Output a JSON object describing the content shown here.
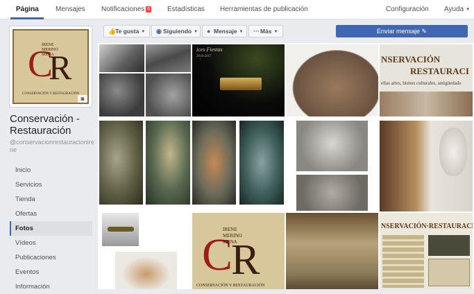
{
  "topnav": {
    "items": [
      "Página",
      "Mensajes",
      "Notificaciones",
      "Estadísticas",
      "Herramientas de publicación"
    ],
    "notifications_badge": "6",
    "settings": "Configuración",
    "help": "Ayuda"
  },
  "page": {
    "name": "Conservación - Restauración",
    "handle": "@conservacionrestauracionirene"
  },
  "logo": {
    "lines": [
      "IRENE",
      "MERINO",
      "MENA"
    ],
    "monogram": "CR",
    "caption": "CONSERVACIÓN Y RESTAURACIÓN"
  },
  "sidenav": {
    "items": [
      "Inicio",
      "Servicios",
      "Tienda",
      "Ofertas",
      "Fotos",
      "Vídeos",
      "Publicaciones",
      "Eventos",
      "Información"
    ],
    "active": "Fotos"
  },
  "actions": {
    "like": "Te gusta",
    "follow": "Siguiendo",
    "message": "Mensaje",
    "more": "Más",
    "send_message": "Enviar mensaje"
  },
  "photo_text": {
    "fiestas_title": "ices Fiestas",
    "fiestas_year": "2016-2017",
    "banner1_title": "NSERVACIÓN",
    "banner1_sub": "RESTAURACI",
    "banner1_line": "ellas artes, bienes culturales, antigüedade",
    "banner2_title": "NSERVACIÓN·RESTAURACI",
    "logo2_lines": [
      "IRENE",
      "MERINO",
      "MENA"
    ],
    "logo2_caption": "CONSERVACIÓN Y RESTAURACIÓN"
  },
  "colors": {
    "accent": "#4267b2",
    "badge": "#fa3e3e",
    "logo_bg": "#d8c79a",
    "logo_red": "#9b1c1c"
  }
}
